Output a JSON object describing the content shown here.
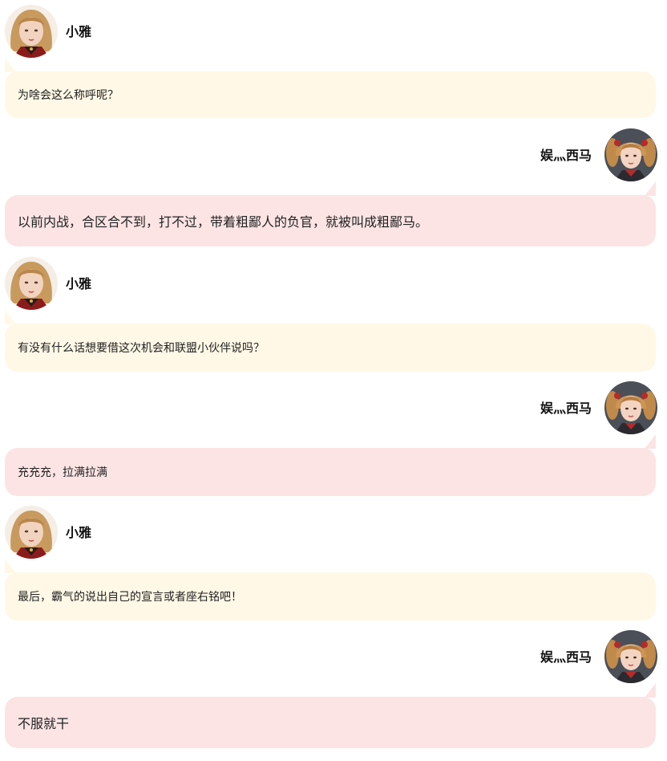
{
  "colors": {
    "left_bubble": "#fff8e6",
    "right_bubble": "#fce4e4"
  },
  "messages": [
    {
      "side": "left",
      "sender": "小雅",
      "avatar": "blonde-girl-avatar",
      "text": "为啥会这么称呼呢？"
    },
    {
      "side": "right",
      "sender": "娱灬西马",
      "avatar": "pigtails-girl-avatar",
      "text": "以前内战，合区合不到，打不过，带着粗鄙人的负官，就被叫成粗鄙马。"
    },
    {
      "side": "left",
      "sender": "小雅",
      "avatar": "blonde-girl-avatar",
      "text": "有没有什么话想要借这次机会和联盟小伙伴说吗？"
    },
    {
      "side": "right",
      "sender": "娱灬西马",
      "avatar": "pigtails-girl-avatar",
      "text": "充充充，拉满拉满"
    },
    {
      "side": "left",
      "sender": "小雅",
      "avatar": "blonde-girl-avatar",
      "text": "最后，霸气的说出自己的宣言或者座右铭吧！"
    },
    {
      "side": "right",
      "sender": "娱灬西马",
      "avatar": "pigtails-girl-avatar",
      "text": "不服就干"
    }
  ]
}
